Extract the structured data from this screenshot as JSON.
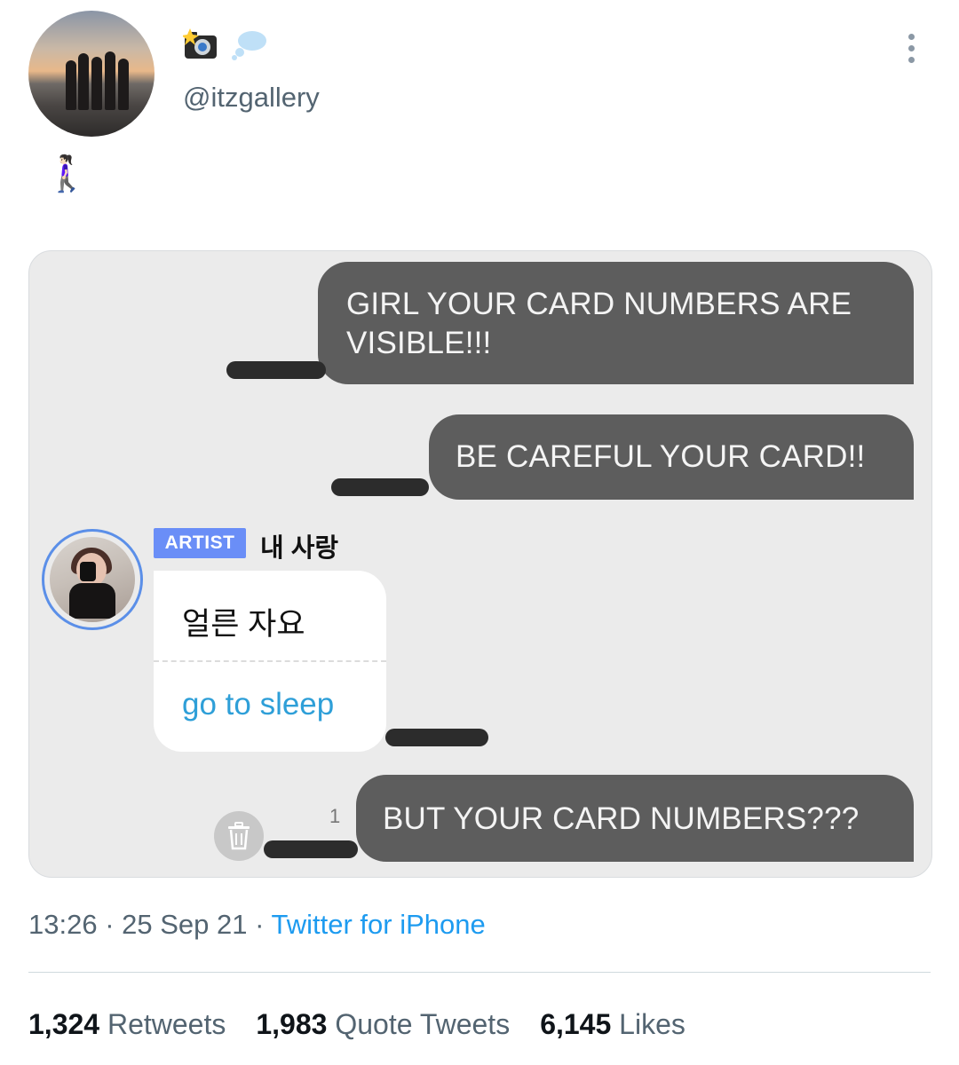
{
  "tweet": {
    "display_name_icons": [
      "camera-flash-icon",
      "thought-bubble-icon"
    ],
    "handle": "@itzgallery",
    "text": "🚶🏻‍♀️"
  },
  "chat": {
    "messages_out": [
      {
        "line1": "GIRL YOUR CARD NUMBERS ARE",
        "line2": "VISIBLE!!!"
      },
      {
        "text": "BE CAREFUL YOUR CARD!!"
      },
      {
        "text": "BUT YOUR CARD NUMBERS???"
      }
    ],
    "artist": {
      "badge": "ARTIST",
      "name": "내 사랑",
      "message_korean": "얼른 자요",
      "message_english": "go to sleep"
    },
    "read_count": "1"
  },
  "meta": {
    "time": "13:26",
    "separator": " · ",
    "date": "25 Sep 21",
    "source": "Twitter for iPhone"
  },
  "stats": {
    "retweets_count": "1,324",
    "retweets_label": "Retweets",
    "quotes_count": "1,983",
    "quotes_label": "Quote Tweets",
    "likes_count": "6,145",
    "likes_label": "Likes"
  },
  "colors": {
    "accent": "#1d9bf0",
    "outgoing_bubble": "#5d5d5d",
    "artist_badge": "#6a8ef7",
    "translation_text": "#2e9fd8"
  }
}
